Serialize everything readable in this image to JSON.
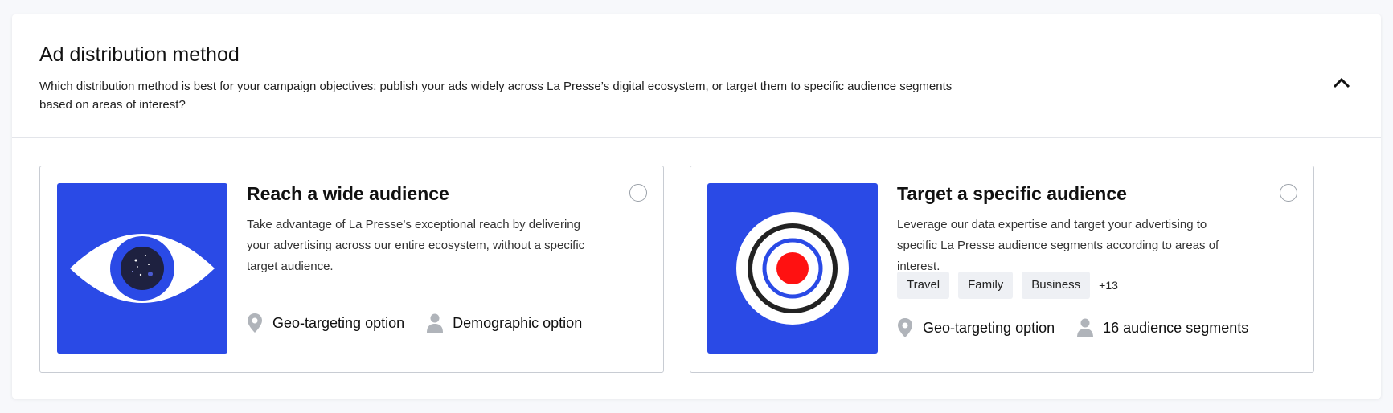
{
  "section": {
    "title": "Ad distribution method",
    "description": "Which distribution method is best for your campaign objectives: publish your ads widely across La Presse’s digital ecosystem, or target them to specific audience segments based on areas of interest?"
  },
  "cards": [
    {
      "title": "Reach a wide audience",
      "text": "Take advantage of La Presse’s exceptional reach by delivering your advertising across our entire ecosystem, without a specific target audience.",
      "options": [
        {
          "icon": "location-pin-icon",
          "label": "Geo-targeting option"
        },
        {
          "icon": "person-icon",
          "label": "Demographic option"
        }
      ]
    },
    {
      "title": "Target a specific audience",
      "text": "Leverage our data expertise and target your advertising to specific La Presse audience segments according to areas of interest.",
      "tags": [
        "Travel",
        "Family",
        "Business"
      ],
      "more": "+13",
      "options": [
        {
          "icon": "location-pin-icon",
          "label": "Geo-targeting option"
        },
        {
          "icon": "person-icon",
          "label": "16 audience segments"
        }
      ]
    }
  ],
  "colors": {
    "illustration_bg": "#2a4ae6",
    "target_red": "#ff1111",
    "border": "#c8ccd3"
  }
}
